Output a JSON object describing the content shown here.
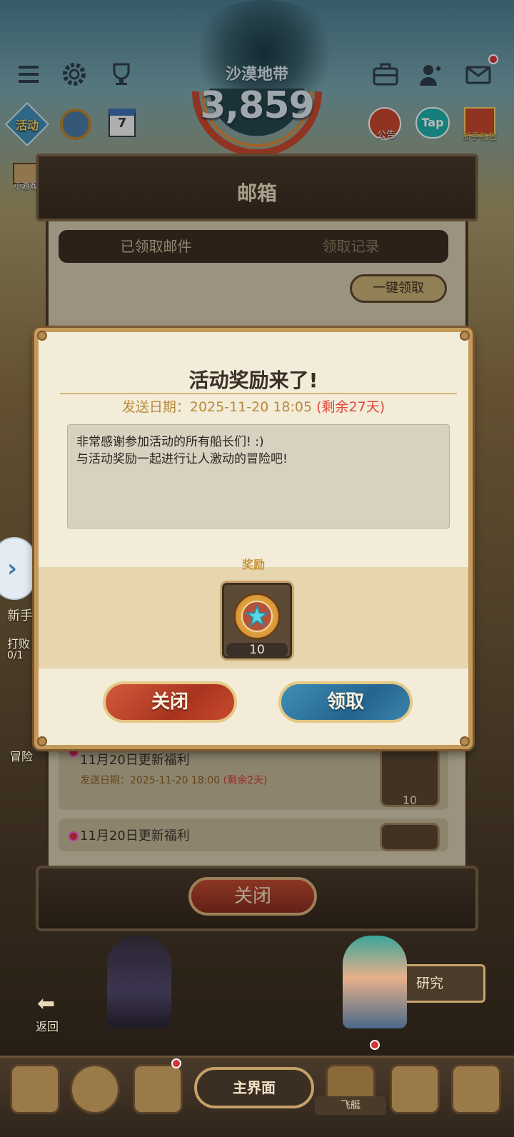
{
  "top": {
    "region_name": "沙漠地带",
    "score": "3,859",
    "left_icons": [
      "menu-icon",
      "gear-icon",
      "trophy-icon"
    ],
    "row2": {
      "activity_label": "活动",
      "calendar_day": "7"
    },
    "right_icons": [
      "toolbox-icon",
      "friends-icon",
      "mail-icon"
    ],
    "row2_right": {
      "notice_label": "公告",
      "tap_label": "Tap",
      "gift_label": "新手礼包"
    },
    "left_small": "小游戏"
  },
  "mailbox": {
    "title": "邮箱",
    "tabs": [
      "已领取邮件",
      "领取记录"
    ],
    "claim_all": "一键领取",
    "rows": [
      {
        "title": "11月20日更新福利",
        "date_prefix": "发送日期：2025-11-20 18:00",
        "remaining": "(剩余2天)",
        "qty": "10"
      },
      {
        "title": "11月20日更新福利"
      }
    ],
    "close": "关闭"
  },
  "dialog": {
    "title": "活动奖励来了!",
    "date_prefix": "发送日期：2025-11-20 18:05",
    "remaining": "(剩余27天)",
    "message_line1": "非常感谢参加活动的所有船长们! :)",
    "message_line2": "与活动奖励一起进行让人激动的冒险吧!",
    "reward_label": "奖励",
    "reward_qty": "10",
    "close_btn": "关闭",
    "claim_btn": "领取"
  },
  "side": {
    "newbie": "新手",
    "defeat": "打败",
    "progress": "0/1",
    "adventure": "冒险",
    "back": "返回",
    "research": "研究"
  },
  "nav": {
    "main": "主界面",
    "ship": "飞艇"
  },
  "colors": {
    "accent_gold": "#c49a5a",
    "claim_blue": "#24648e",
    "close_red": "#a8341f",
    "remaining_red": "#e0453a"
  }
}
